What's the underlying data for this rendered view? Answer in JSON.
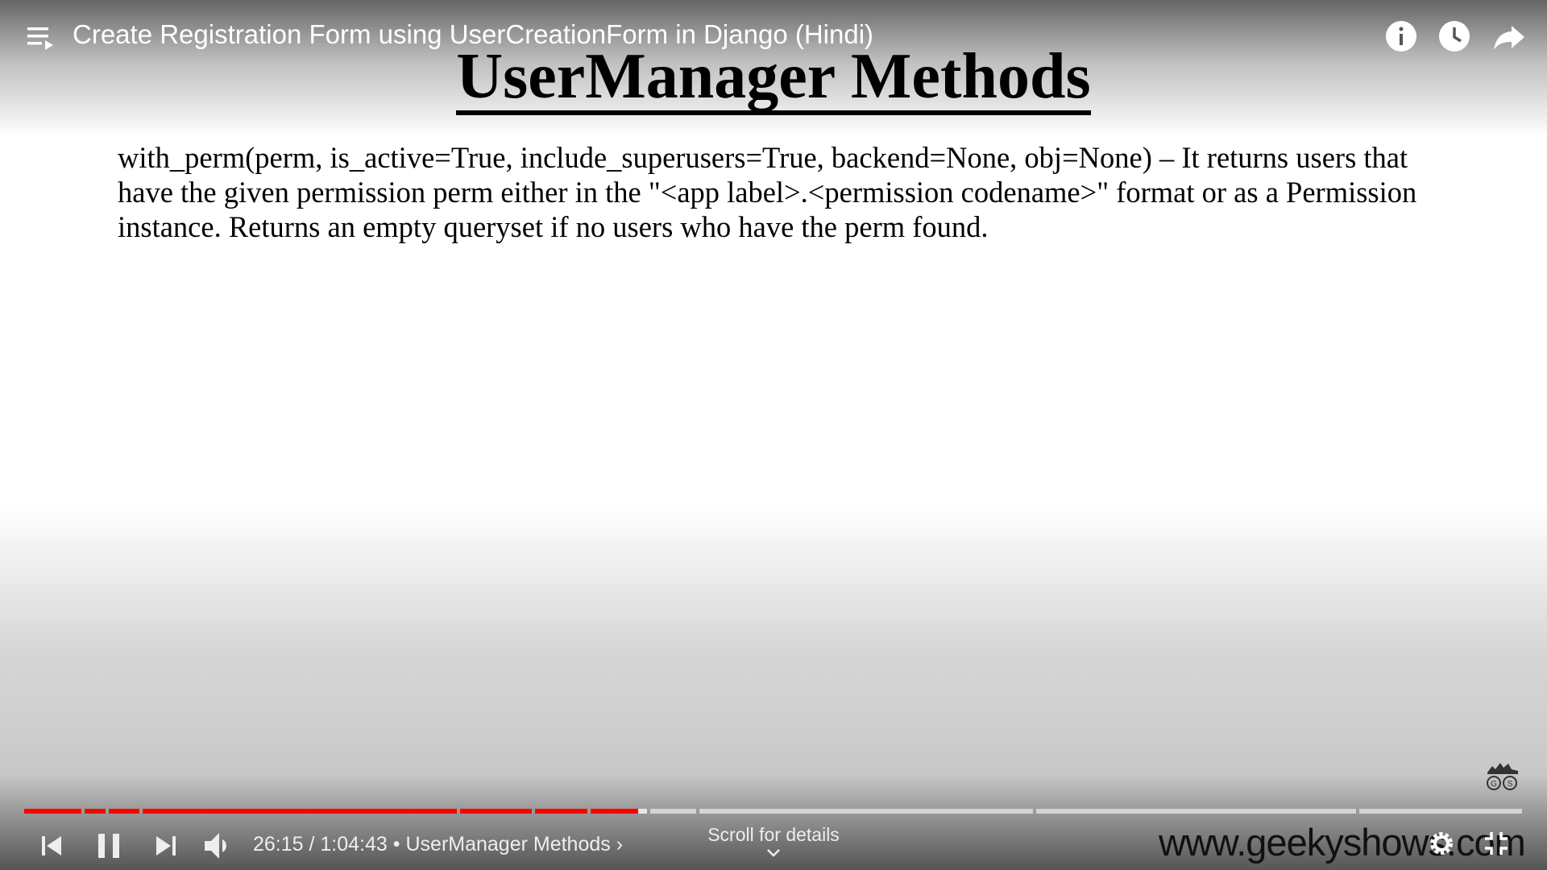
{
  "header": {
    "video_title": "Create Registration Form using UserCreationForm in Django (Hindi)",
    "icons": [
      "playlist-icon",
      "info-icon",
      "watch-later-icon",
      "share-icon"
    ]
  },
  "slide": {
    "title": "UserManager Methods",
    "body": "with_perm(perm, is_active=True, include_superusers=True, backend=None, obj=None) – It returns users that have the given permission perm either in the \"<app label>.<permission codename>\" format or as a Permission instance. Returns an empty queryset if no users who have the perm found."
  },
  "player": {
    "current_time": "26:15",
    "duration": "1:04:43",
    "separator": " / ",
    "bullet": " • ",
    "chapter": "UserManager Methods",
    "chapter_arrow": "›",
    "scroll_hint": "Scroll for details",
    "progress_fraction": 0.4056,
    "accent_color": "#ff0000"
  },
  "watermark": {
    "site": "www.geekyshows.com",
    "logo_letters": "GS"
  }
}
